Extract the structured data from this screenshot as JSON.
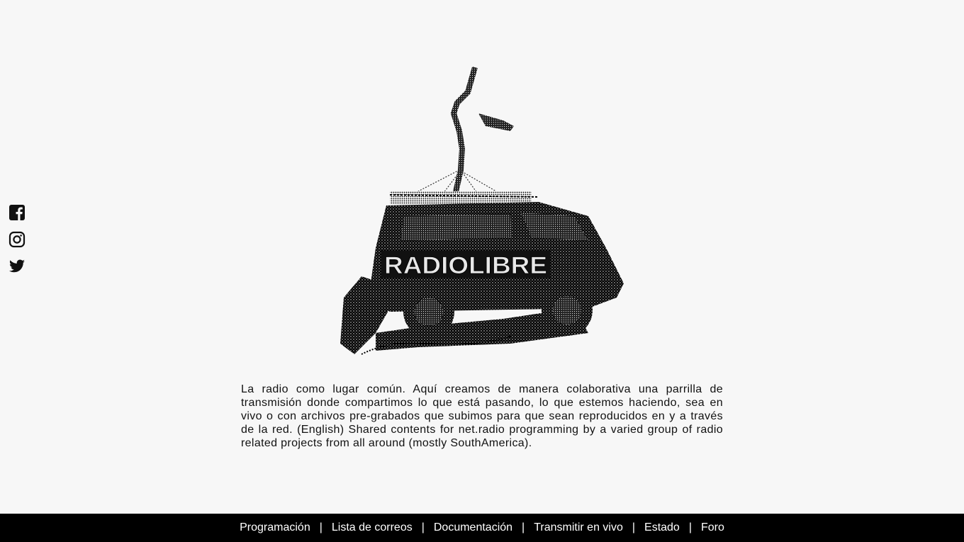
{
  "social": {
    "items": [
      {
        "icon": "facebook-icon",
        "label": "Facebook"
      },
      {
        "icon": "instagram-icon",
        "label": "Instagram"
      },
      {
        "icon": "twitter-icon",
        "label": "Twitter"
      }
    ]
  },
  "hero": {
    "logo_text": "RADIOLIBRE"
  },
  "description": "La radio como lugar común. Aquí creamos de manera colaborativa una parrilla de transmisión donde compartimos lo que está pasando, lo que estemos haciendo, sea en vivo o con archivos pre-grabados que subimos para que sean reproducidos en y a través de la red. (English) Shared contents for net.radio programming by a varied group of radio related projects from all around (mostly SouthAmerica).",
  "footer": {
    "separator": "|",
    "links": [
      "Programación",
      "Lista de correos",
      "Documentación",
      "Transmitir en vivo",
      "Estado",
      "Foro"
    ]
  },
  "colors": {
    "background": "#f7f7f7",
    "footer_background": "#000000",
    "footer_text": "#ffffff",
    "text": "#111111"
  }
}
